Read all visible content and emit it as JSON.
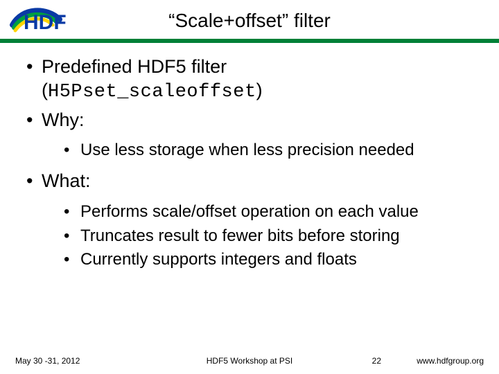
{
  "header": {
    "title": "“Scale+offset”  filter",
    "logo_alt": "HDF logo"
  },
  "body": {
    "predefined_line1": "Predefined HDF5 filter",
    "predefined_line2_open": "(",
    "predefined_line2_code": "H5Pset_scaleoffset",
    "predefined_line2_close": ")",
    "why_label": "Why:",
    "why_items": [
      "Use less storage when less precision needed"
    ],
    "what_label": "What:",
    "what_items": [
      "Performs scale/offset operation on each value",
      "Truncates result to fewer bits before storing",
      "Currently supports integers and floats"
    ]
  },
  "footer": {
    "date": "May 30 -31, 2012",
    "event": "HDF5 Workshop at PSI",
    "page": "22",
    "url": "www.hdfgroup.org"
  }
}
